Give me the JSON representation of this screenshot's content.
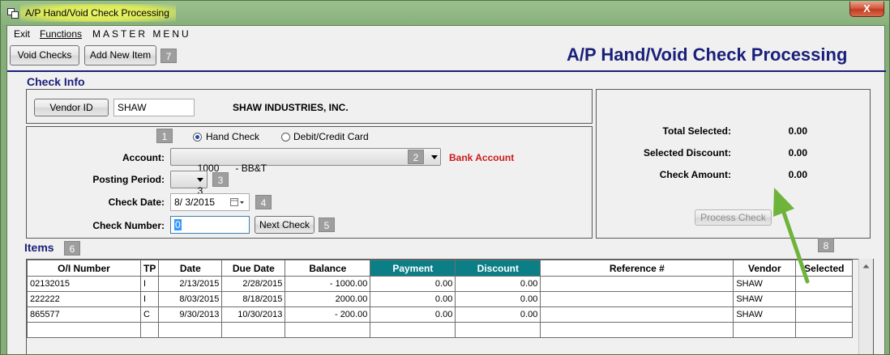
{
  "window": {
    "title": "A/P Hand/Void Check Processing",
    "close_glyph": "X"
  },
  "menu": {
    "exit": "Exit",
    "functions": "Functions",
    "master": "MASTER MENU"
  },
  "toolbar": {
    "void_checks": "Void Checks",
    "add_new_item": "Add New Item"
  },
  "page_title": "A/P Hand/Void Check Processing",
  "check_info": {
    "section_title": "Check Info",
    "vendor_button": "Vendor ID",
    "vendor_id_value": "SHAW",
    "vendor_name": "SHAW INDUSTRIES, INC.",
    "hand_check_label": "Hand Check",
    "card_label": "Debit/Credit Card",
    "selected_payment_type": "Hand Check",
    "account_label": "Account:",
    "account_value": "1000      - BB&T",
    "bank_account_label": "Bank Account",
    "posting_period_label": "Posting Period:",
    "posting_period_value": "3",
    "check_date_label": "Check Date:",
    "check_date_value": "8/  3/2015",
    "check_number_label": "Check Number:",
    "check_number_value": "0",
    "next_check_button": "Next Check"
  },
  "totals": {
    "total_selected_label": "Total Selected:",
    "total_selected_value": "0.00",
    "selected_discount_label": "Selected Discount:",
    "selected_discount_value": "0.00",
    "check_amount_label": "Check Amount:",
    "check_amount_value": "0.00",
    "process_check_button": "Process Check"
  },
  "items": {
    "section_title": "Items",
    "columns": [
      "O/I Number",
      "TP",
      "Date",
      "Due Date",
      "Balance",
      "Payment",
      "Discount",
      "Reference #",
      "Vendor",
      "Selected"
    ],
    "rows": [
      [
        "02132015",
        "I",
        "2/13/2015",
        "2/28/2015",
        "-   1000.00",
        "0.00",
        "0.00",
        "",
        "SHAW",
        ""
      ],
      [
        "222222",
        "I",
        "8/03/2015",
        "8/18/2015",
        "2000.00",
        "0.00",
        "0.00",
        "",
        "SHAW",
        ""
      ],
      [
        "865577",
        "C",
        "9/30/2013",
        "10/30/2013",
        "-   200.00",
        "0.00",
        "0.00",
        "",
        "SHAW",
        ""
      ]
    ]
  },
  "badges": [
    "1",
    "2",
    "3",
    "4",
    "5",
    "6",
    "7",
    "8"
  ],
  "colors": {
    "title_blue": "#1a1f7a",
    "teal_header": "#0c7f86",
    "bank_account_red": "#cc1a1a",
    "arrow_green": "#6fb43a"
  }
}
